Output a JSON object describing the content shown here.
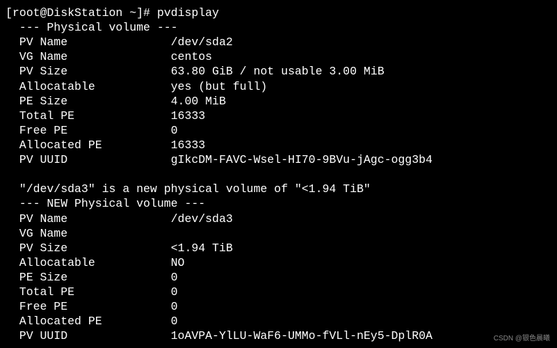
{
  "prompt": "[root@DiskStation ~]# ",
  "command": "pvdisplay",
  "sectionHeader1": "  --- Physical volume ---",
  "pv1": {
    "nameLabel": "  PV Name               ",
    "nameValue": "/dev/sda2",
    "vgLabel": "  VG Name               ",
    "vgValue": "centos",
    "sizeLabel": "  PV Size               ",
    "sizeValue": "63.80 GiB / not usable 3.00 MiB",
    "allocLabel": "  Allocatable           ",
    "allocValue": "yes (but full)",
    "peLabel": "  PE Size               ",
    "peValue": "4.00 MiB",
    "totLabel": "  Total PE              ",
    "totValue": "16333",
    "freeLabel": "  Free PE               ",
    "freeValue": "0",
    "apeLabel": "  Allocated PE          ",
    "apeValue": "16333",
    "uuidLabel": "  PV UUID               ",
    "uuidValue": "gIkcDM-FAVC-Wsel-HI70-9BVu-jAgc-ogg3b4"
  },
  "blank": " ",
  "newNotice": "  \"/dev/sda3\" is a new physical volume of \"<1.94 TiB\"",
  "sectionHeader2": "  --- NEW Physical volume ---",
  "pv2": {
    "nameLabel": "  PV Name               ",
    "nameValue": "/dev/sda3",
    "vgLabel": "  VG Name               ",
    "vgValue": "",
    "sizeLabel": "  PV Size               ",
    "sizeValue": "<1.94 TiB",
    "allocLabel": "  Allocatable           ",
    "allocValue": "NO",
    "peLabel": "  PE Size               ",
    "peValue": "0",
    "totLabel": "  Total PE              ",
    "totValue": "0",
    "freeLabel": "  Free PE               ",
    "freeValue": "0",
    "apeLabel": "  Allocated PE          ",
    "apeValue": "0",
    "uuidLabel": "  PV UUID               ",
    "uuidValue": "1oAVPA-YlLU-WaF6-UMMo-fVLl-nEy5-DplR0A"
  },
  "watermark": "CSDN @银色晨曦"
}
